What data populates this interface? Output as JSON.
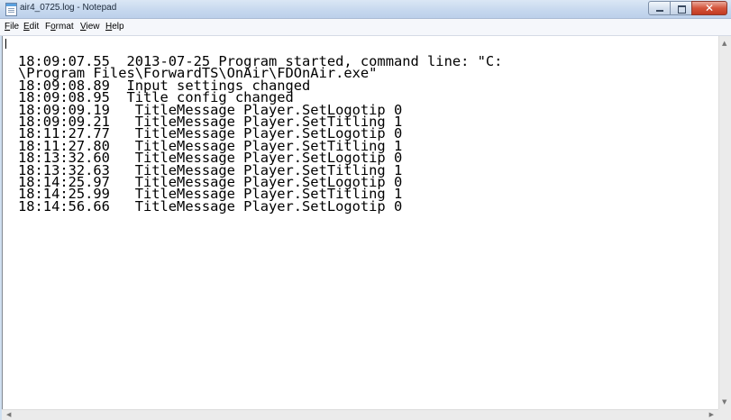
{
  "window": {
    "title": "air4_0725.log - Notepad",
    "icon": "notepad-icon",
    "controls": {
      "minimize_icon": "minimize-icon",
      "maximize_icon": "maximize-icon",
      "close_glyph": "✕"
    }
  },
  "menu": {
    "items": [
      "File",
      "Edit",
      "Format",
      "View",
      "Help"
    ],
    "mnemonics": [
      "F",
      "E",
      "o",
      "V",
      "H"
    ]
  },
  "editor": {
    "lines": [
      "18:09:07.55  2013-07-25 Program started, command line: \"C:",
      "\\Program Files\\ForwardTS\\OnAir\\FDOnAir.exe\"",
      "18:09:08.89  Input settings changed",
      "18:09:08.95  Title config changed",
      "18:09:09.19   TitleMessage Player.SetLogotip 0",
      "18:09:09.21   TitleMessage Player.SetTitling 1",
      "18:11:27.77   TitleMessage Player.SetLogotip 0",
      "18:11:27.80   TitleMessage Player.SetTitling 1",
      "18:13:32.60   TitleMessage Player.SetLogotip 0",
      "18:13:32.63   TitleMessage Player.SetTitling 1",
      "18:14:25.97   TitleMessage Player.SetLogotip 0",
      "18:14:25.99   TitleMessage Player.SetTitling 1",
      "18:14:56.66   TitleMessage Player.SetLogotip 0"
    ]
  },
  "scrollbars": {
    "up_arrow": "▲",
    "down_arrow": "▼",
    "left_arrow": "◀",
    "right_arrow": "▶"
  },
  "colors": {
    "title_bar": "#c5d7ee",
    "close_button": "#d4553c",
    "editor_background": "#ffffff"
  }
}
